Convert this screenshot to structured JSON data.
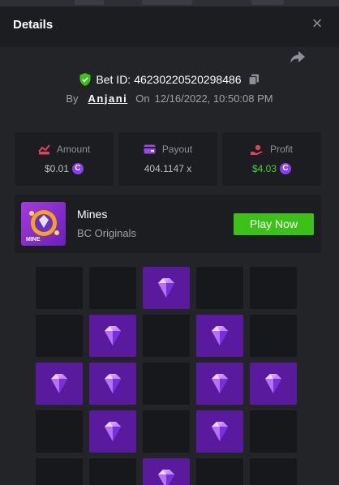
{
  "header": {
    "title": "Details",
    "close_icon": "close-icon"
  },
  "bet": {
    "label": "Bet ID:",
    "id": "46230220520298486"
  },
  "author": {
    "by": "By",
    "username": "Anjani",
    "on": "On",
    "datetime": "12/16/2022, 10:50:08 PM"
  },
  "stats": {
    "amount": {
      "label": "Amount",
      "value": "$0.01",
      "icon": "money-icon"
    },
    "payout": {
      "label": "Payout",
      "value": "404.1147 x",
      "icon": "wallet-icon"
    },
    "profit": {
      "label": "Profit",
      "value": "$4.03",
      "icon": "profit-hand-icon"
    }
  },
  "game": {
    "name": "Mines",
    "provider": "BC Originals",
    "play_label": "Play Now",
    "thumb_label": "MINE"
  },
  "grid": {
    "rows": 5,
    "cols": 5,
    "cells": [
      "empty",
      "empty",
      "gem",
      "empty",
      "empty",
      "empty",
      "gem",
      "empty",
      "gem",
      "empty",
      "gem",
      "gem",
      "empty",
      "gem",
      "gem",
      "empty",
      "gem",
      "empty",
      "gem",
      "empty",
      "empty",
      "empty",
      "gem",
      "empty",
      "empty"
    ]
  },
  "colors": {
    "accent": "#3bc117",
    "profit": "#43d23e",
    "gem_tile": "#5a1a9e",
    "coin": "#8b3ef5",
    "shield": "#3bc117"
  }
}
